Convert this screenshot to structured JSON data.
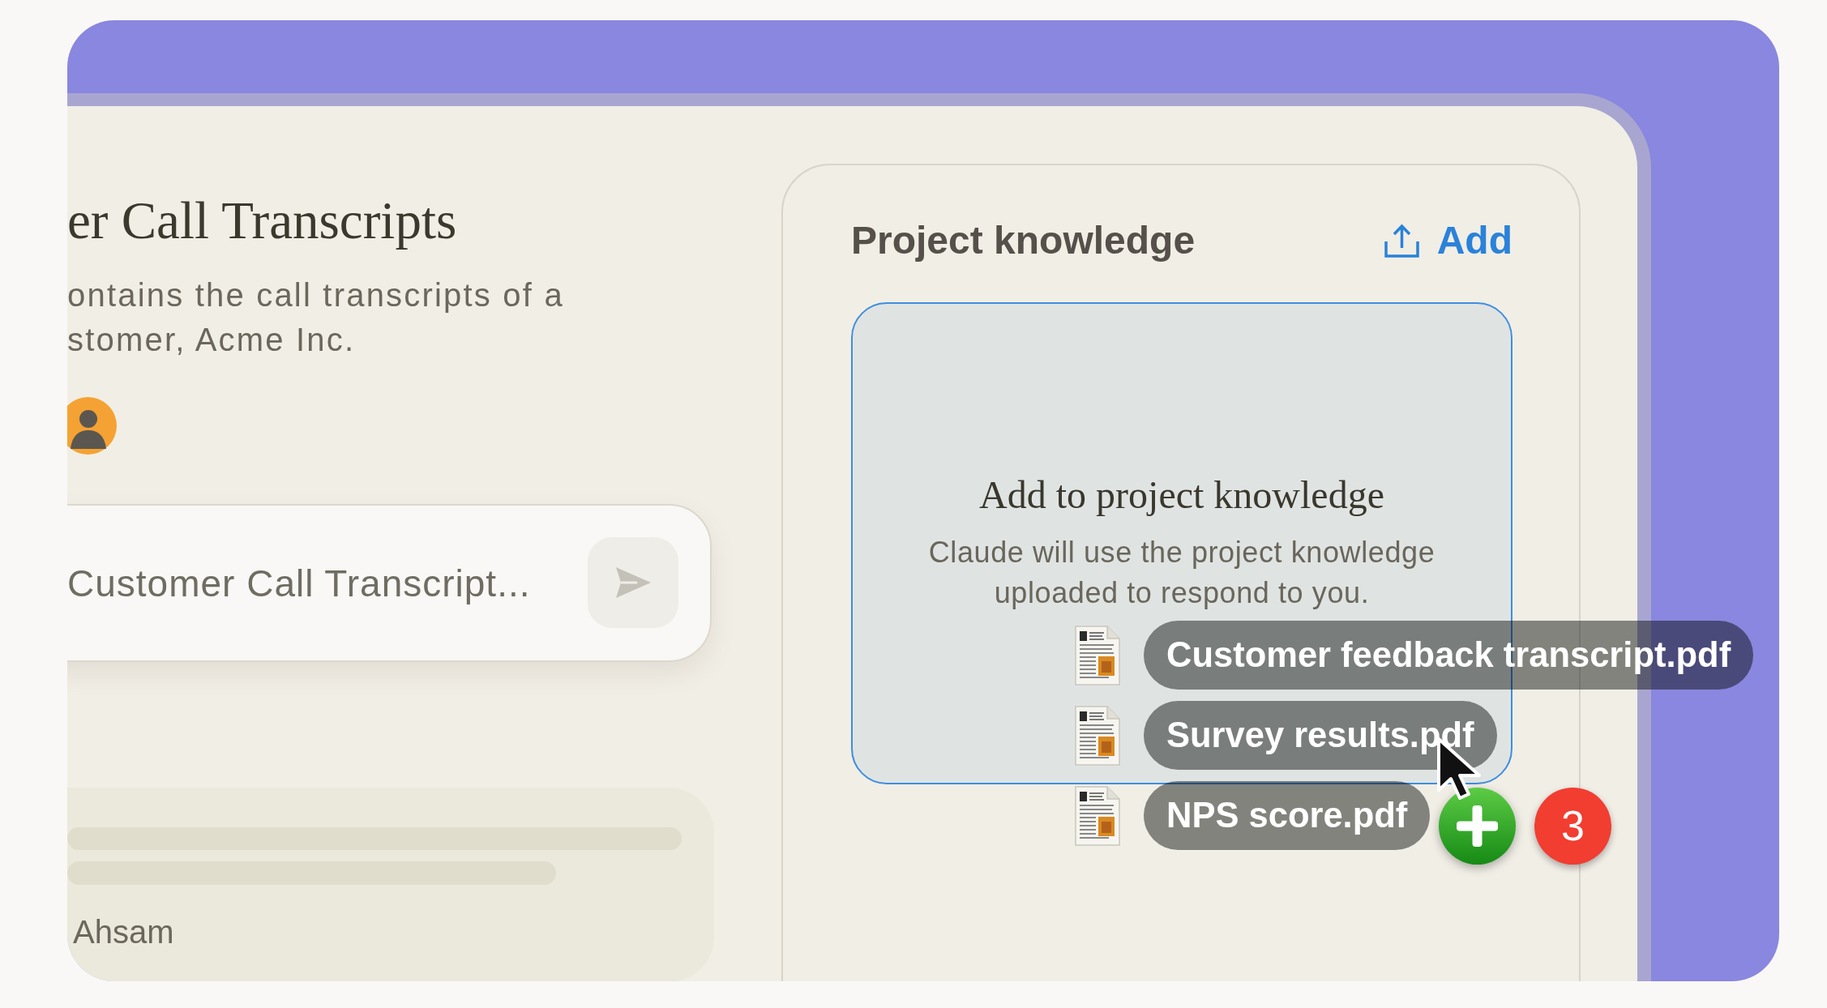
{
  "project": {
    "title": "er Call Transcripts",
    "description_lines": [
      "ontains the call transcripts of a",
      "stomer, Acme Inc."
    ]
  },
  "chat_input": {
    "placeholder": "Customer Call Transcript..."
  },
  "conversation_card": {
    "author": "Ahsam"
  },
  "knowledge_panel": {
    "title": "Project knowledge",
    "add_button": "Add",
    "drop_zone": {
      "active": true,
      "heading": "Add to project knowledge",
      "text": "Claude will use the project knowledge uploaded to respond to you."
    }
  },
  "dragged_files": {
    "files": [
      {
        "name": "Customer feedback transcript.pdf"
      },
      {
        "name": "Survey results.pdf"
      },
      {
        "name": "NPS score.pdf"
      }
    ],
    "count": "3"
  }
}
